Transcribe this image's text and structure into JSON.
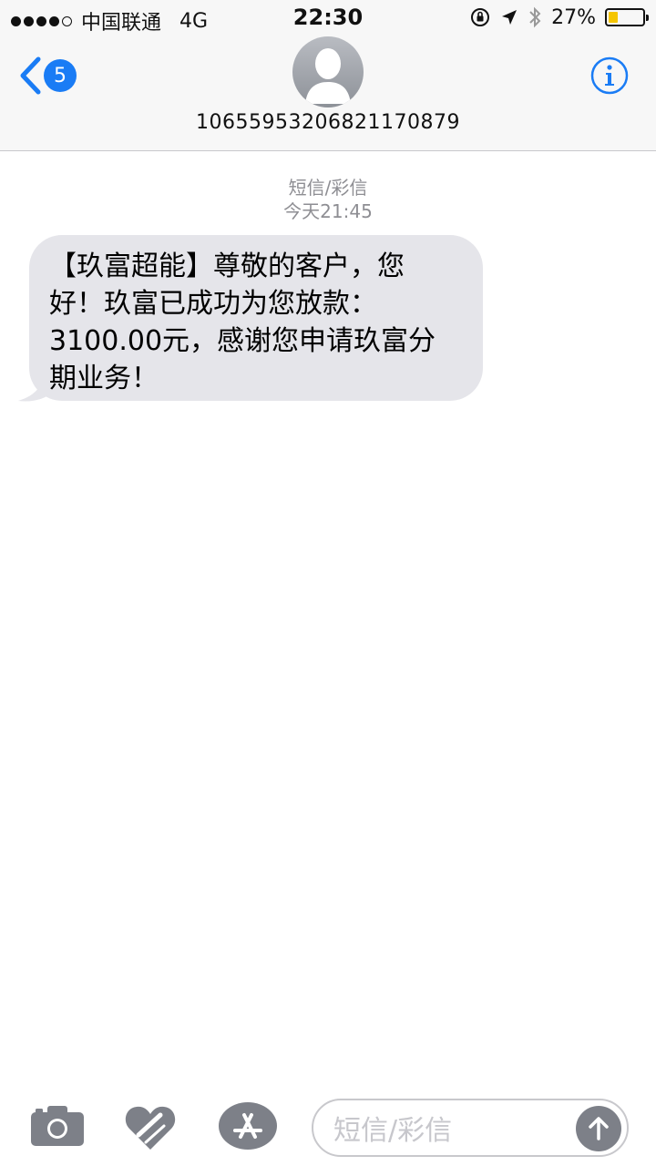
{
  "status_bar": {
    "carrier": "中国联通",
    "network": "4G",
    "time": "22:30",
    "battery": "27%",
    "battery_level": 0.27,
    "icons": [
      "orientation-lock-icon",
      "location-arrow-icon",
      "bluetooth-icon",
      "battery-icon"
    ]
  },
  "nav": {
    "back_count": "5",
    "contact": "10655953206821170879",
    "icons": [
      "back-chevron-icon",
      "contact-avatar-icon",
      "info-icon"
    ]
  },
  "conversation": {
    "service_type": "短信/彩信",
    "timestamp": "今天21:45",
    "messages": [
      {
        "direction": "incoming",
        "lines": [
          "【玖富超能】尊敬的客户，您",
          "好！玖富已成功为您放款：",
          "3100.00元，感谢您申请玖富分",
          "期业务！"
        ]
      }
    ]
  },
  "toolbar": {
    "input_placeholder": "短信/彩信",
    "icons": [
      "camera-icon",
      "digital-touch-icon",
      "app-store-icon",
      "send-arrow-icon"
    ]
  },
  "colors": {
    "accent": "#1a7cf5",
    "bubble": "#e5e5ea",
    "meta_text": "#8e8e93",
    "battery_fill": "#f5c500"
  }
}
